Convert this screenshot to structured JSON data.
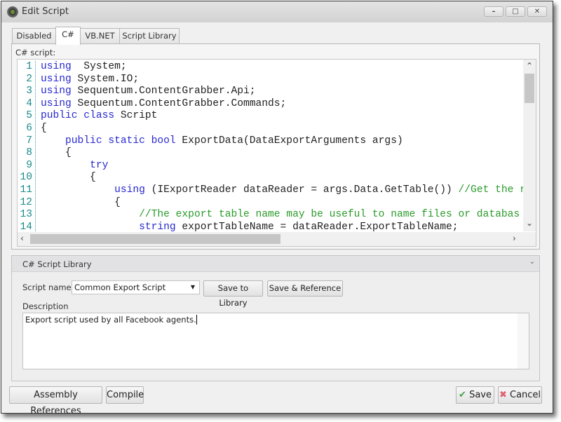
{
  "window": {
    "title": "Edit Script",
    "minimize": "–",
    "maximize": "□",
    "close": "✕"
  },
  "tabs": [
    {
      "label": "Disabled"
    },
    {
      "label": "C#",
      "active": true
    },
    {
      "label": "VB.NET"
    },
    {
      "label": "Script Library"
    }
  ],
  "editor": {
    "label": "C# script:",
    "colors": {
      "keyword": "#2828d0",
      "comment": "#2a9a2a",
      "line_number": "#1a8a8a"
    },
    "lines": [
      [
        [
          "k",
          "using"
        ],
        [
          "",
          "  System;"
        ]
      ],
      [
        [
          "k",
          "using"
        ],
        [
          "",
          " System.IO;"
        ]
      ],
      [
        [
          "k",
          "using"
        ],
        [
          "",
          " Sequentum.ContentGrabber.Api;"
        ]
      ],
      [
        [
          "k",
          "using"
        ],
        [
          "",
          " Sequentum.ContentGrabber.Commands;"
        ]
      ],
      [
        [
          "k",
          "public class"
        ],
        [
          "",
          " Script"
        ]
      ],
      [
        [
          "",
          "{"
        ]
      ],
      [
        [
          "",
          "    "
        ],
        [
          "k",
          "public static bool"
        ],
        [
          "",
          " ExportData(DataExportArguments args)"
        ]
      ],
      [
        [
          "",
          "    {"
        ]
      ],
      [
        [
          "",
          "        "
        ],
        [
          "k",
          "try"
        ]
      ],
      [
        [
          "",
          "        {"
        ]
      ],
      [
        [
          "",
          "            "
        ],
        [
          "k",
          "using"
        ],
        [
          "",
          " (IExportReader dataReader = args.Data.GetTable()) "
        ],
        [
          "c",
          "//Get the r"
        ]
      ],
      [
        [
          "",
          "            {"
        ]
      ],
      [
        [
          "",
          "                "
        ],
        [
          "c",
          "//The export table name may be useful to name files or databas"
        ]
      ],
      [
        [
          "",
          "                "
        ],
        [
          "k",
          "string"
        ],
        [
          "",
          " exportTableName = dataReader.ExportTableName;"
        ]
      ]
    ]
  },
  "library": {
    "header": "C# Script Library",
    "script_name_label": "Script name:",
    "script_name_value": "Common Export Script",
    "save_to_library": "Save to Library",
    "save_and_reference": "Save & Reference",
    "description_label": "Description",
    "description_value": "Export script used by all Facebook agents."
  },
  "footer": {
    "assembly_references": "Assembly References",
    "compile": "Compile",
    "save": "Save",
    "cancel": "Cancel",
    "save_icon": "✔",
    "cancel_icon": "✖"
  }
}
